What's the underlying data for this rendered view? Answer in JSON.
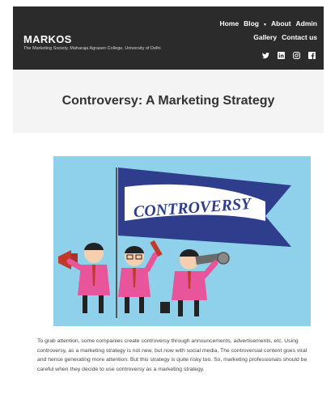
{
  "site": {
    "title": "MARKOS",
    "subtitle": "The Marketing Society, Maharaja Agrasen College, University of Delhi"
  },
  "nav": {
    "row1": [
      "Home",
      "Blog",
      "About",
      "Admin"
    ],
    "row2": [
      "Gallery",
      "Contact us"
    ],
    "blog_caret": "▾"
  },
  "social": [
    "twitter-icon",
    "linkedin-icon",
    "instagram-icon",
    "facebook-icon"
  ],
  "page": {
    "title": "Controversy: A Marketing Strategy"
  },
  "hero": {
    "flag_text": "CONTROVERSY",
    "colors": {
      "background": "#8fd0ea",
      "flag": "#2f3e8c",
      "shirt": "#e8559a"
    }
  },
  "article": {
    "paragraph": "To grab attention, some companies create controversy through announcements, advertisements, etc. Using controversy, as a marketing strategy is not new, but now with social media, The controversial content goes viral and hence generating more attention. But this strategy is quite risky too. So, marketing professionals should be careful when they decide to use controversy as a marketing strategy."
  }
}
